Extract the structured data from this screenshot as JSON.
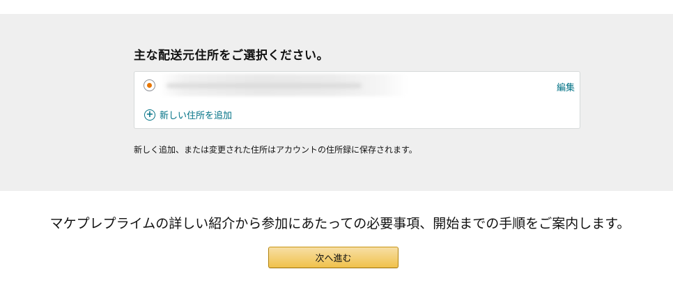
{
  "address_section": {
    "heading": "主な配送元住所をご選択ください。",
    "selected_address": {
      "edit_label": "編集"
    },
    "add_address_label": "新しい住所を追加",
    "add_icon": "plus-circle-icon",
    "note": "新しく追加、または変更された住所はアカウントの住所録に保存されます。"
  },
  "guide": {
    "text": "マケプレプライムの詳しい紹介から参加にあたっての必要事項、開始までの手順をご案内します。"
  },
  "next_button": {
    "label": "次へ進む"
  },
  "colors": {
    "section_background": "#efefef",
    "radio_selected": "#e77600",
    "link": "#007185",
    "button_top": "#f7dfa5",
    "button_bottom": "#f0c14b"
  }
}
